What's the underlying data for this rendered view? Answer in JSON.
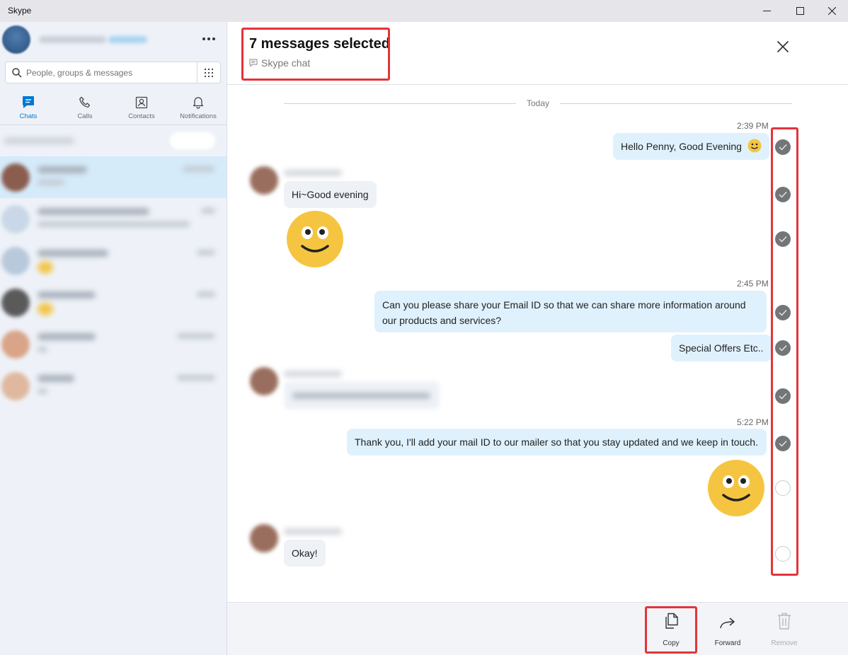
{
  "app": {
    "title": "Skype"
  },
  "window_controls": {
    "minimize": "minimize-icon",
    "maximize": "maximize-icon",
    "close": "close-icon"
  },
  "sidebar": {
    "search": {
      "placeholder": "People, groups & messages"
    },
    "tabs": [
      {
        "label": "Chats",
        "icon": "chat-icon",
        "active": true
      },
      {
        "label": "Calls",
        "icon": "phone-icon",
        "active": false
      },
      {
        "label": "Contacts",
        "icon": "contacts-icon",
        "active": false
      },
      {
        "label": "Notifications",
        "icon": "bell-icon",
        "active": false
      }
    ]
  },
  "selection": {
    "title": "7 messages selected",
    "subtitle": "Skype chat"
  },
  "conversation": {
    "day_label": "Today",
    "timestamps": [
      "2:39 PM",
      "2:45 PM",
      "5:22 PM"
    ],
    "messages": [
      {
        "direction": "out",
        "text": "Hello Penny, Good Evening",
        "selected": true
      },
      {
        "direction": "in",
        "text": "Hi~Good evening",
        "selected": true
      },
      {
        "direction": "in",
        "text": "",
        "emoji": "smiley-emoji",
        "selected": true
      },
      {
        "direction": "out",
        "text": "Can you please share your Email ID so that we can share more information around our products and services?",
        "selected": true
      },
      {
        "direction": "out",
        "text": "Special Offers Etc..",
        "selected": true
      },
      {
        "direction": "in",
        "text": "",
        "blurred": true,
        "selected": true
      },
      {
        "direction": "out",
        "text": "Thank you, I'll add your mail ID to our mailer so that you stay updated and we keep in touch.",
        "selected": true
      },
      {
        "direction": "out",
        "text": "",
        "emoji": "smiley-emoji",
        "selected": false
      },
      {
        "direction": "in",
        "text": "Okay!",
        "selected": false
      }
    ]
  },
  "footer": {
    "copy_label": "Copy",
    "forward_label": "Forward",
    "remove_label": "Remove"
  },
  "colors": {
    "accent": "#0078d4",
    "highlight": "#e3343a",
    "outgoing_bubble": "#dff1fd",
    "incoming_bubble": "#eef2f7",
    "selected_chat": "#d5ebfa"
  }
}
